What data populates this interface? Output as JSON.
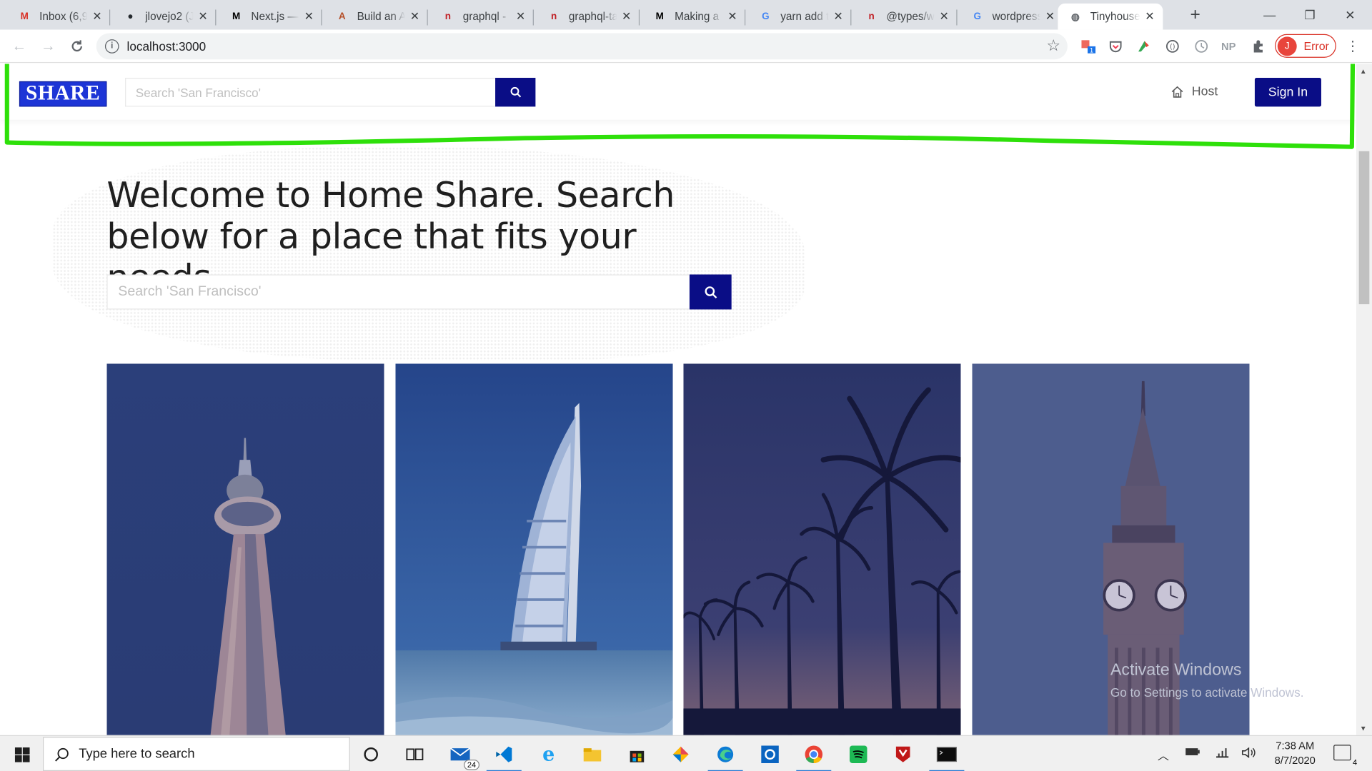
{
  "browser": {
    "tabs": [
      {
        "title": "Inbox (6,9",
        "icon": "gmail-icon",
        "glyph": "M",
        "color": "#d93025"
      },
      {
        "title": "jlovejo2 (J",
        "icon": "github-icon",
        "glyph": "●",
        "color": "#24292e"
      },
      {
        "title": "Next.js —",
        "icon": "medium-icon",
        "glyph": "M",
        "color": "#000000"
      },
      {
        "title": "Build an A",
        "icon": "apollo-icon",
        "glyph": "A",
        "color": "#b5502a"
      },
      {
        "title": "graphql -",
        "icon": "npm-icon",
        "glyph": "n",
        "color": "#c12127"
      },
      {
        "title": "graphql-ta",
        "icon": "npm-icon",
        "glyph": "n",
        "color": "#c12127"
      },
      {
        "title": "Making a",
        "icon": "medium-icon",
        "glyph": "M",
        "color": "#000000"
      },
      {
        "title": "yarn add t",
        "icon": "google-icon",
        "glyph": "G",
        "color": "#4285f4"
      },
      {
        "title": "@types/w",
        "icon": "npm-icon",
        "glyph": "n",
        "color": "#c12127"
      },
      {
        "title": "wordpress",
        "icon": "google-icon",
        "glyph": "G",
        "color": "#4285f4"
      },
      {
        "title": "Tinyhouse",
        "icon": "globe-icon",
        "glyph": "◍",
        "color": "#5f6368",
        "active": true
      }
    ],
    "address": "localhost:3000",
    "profile_status": "Error",
    "profile_initial": "J",
    "extension_labels": [
      "NP"
    ]
  },
  "app": {
    "logo_text": "SHARE",
    "header_search_placeholder": "Search 'San Francisco'",
    "host_label": "Host",
    "signin_label": "Sign In",
    "hero_title": "Welcome to Home Share. Search below for a place that fits your needs.",
    "hero_search_placeholder": "Search 'San Francisco'",
    "brand_color": "#0a0d86",
    "logo_color": "#1d35d6",
    "annotation_color": "#2ee00a",
    "cards": [
      {
        "name": "toronto",
        "subject": "CN Tower"
      },
      {
        "name": "dubai",
        "subject": "Burj Al Arab"
      },
      {
        "name": "los-angeles",
        "subject": "Palm trees"
      },
      {
        "name": "london",
        "subject": "Big Ben"
      }
    ]
  },
  "watermark": {
    "line1": "Activate Windows",
    "line2": "Go to Settings to activate Windows."
  },
  "taskbar": {
    "search_placeholder": "Type here to search",
    "mail_badge": "24",
    "time": "7:38 AM",
    "date": "8/7/2020",
    "notification_count": "4"
  }
}
